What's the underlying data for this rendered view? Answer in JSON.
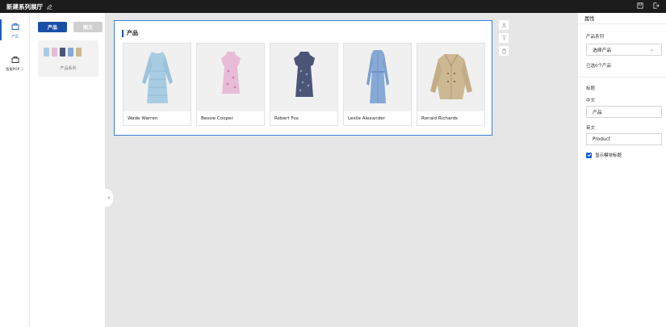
{
  "app": {
    "title": "新建系列展厅"
  },
  "rail": {
    "items": [
      {
        "label": "产品"
      },
      {
        "label": "智能POP ⓘ"
      }
    ]
  },
  "panel": {
    "tabs": [
      {
        "label": "产品"
      },
      {
        "label": "图文"
      }
    ],
    "component_caption": "产品系列"
  },
  "module": {
    "title": "产品",
    "products": [
      {
        "name": "Wade Warren",
        "color": "#a8cde2"
      },
      {
        "name": "Bessie Cooper",
        "color": "#e8bcd6"
      },
      {
        "name": "Robert Fox",
        "color": "#4a5578"
      },
      {
        "name": "Leslie Alexander",
        "color": "#86a9d6"
      },
      {
        "name": "Ronald Richards",
        "color": "#cdb894"
      }
    ]
  },
  "props": {
    "header": "属性",
    "series_label": "产品系列",
    "series_select": "选择产品",
    "selected_count": "已选0个产品",
    "title_section": "标题",
    "cn_label": "中文",
    "cn_value": "产品",
    "en_label": "英文",
    "en_value": "Product",
    "show_title": "显示模块标题"
  },
  "colors": {
    "accent": "#1a4fa8",
    "selection_border": "#3b82d6",
    "topbar": "#1c1c1c",
    "canvas": "#e6e6e6"
  }
}
